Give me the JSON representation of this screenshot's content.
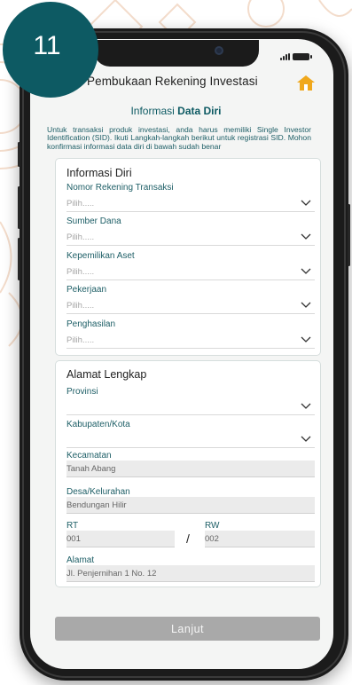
{
  "step_badge": "11",
  "header": {
    "title": "Pembukaan Rekening Investasi",
    "home_icon": "home-icon"
  },
  "section": {
    "title_prefix": "Informasi ",
    "title_bold": "Data Diri"
  },
  "info_text": "Untuk transaksi produk investasi, anda harus memiliki Single Investor Identification (SID). Ikuti Langkah-langkah berikut untuk registrasi SID. Mohon konfirmasi informasi data diri di bawah sudah benar",
  "personal": {
    "title": "Informasi Diri",
    "fields": [
      {
        "label": "Nomor Rekening Transaksi",
        "placeholder": "Pilih....."
      },
      {
        "label": "Sumber Dana",
        "placeholder": "Pilih....."
      },
      {
        "label": "Kepemilikan Aset",
        "placeholder": "Pilih....."
      },
      {
        "label": "Pekerjaan",
        "placeholder": "Pilih....."
      },
      {
        "label": "Penghasilan",
        "placeholder": "Pilih....."
      }
    ]
  },
  "address": {
    "title": "Alamat Lengkap",
    "provinsi": {
      "label": "Provinsi",
      "value": ""
    },
    "kabupaten": {
      "label": "Kabupaten/Kota",
      "value": ""
    },
    "kecamatan": {
      "label": "Kecamatan",
      "value": "Tanah Abang"
    },
    "desa": {
      "label": "Desa/Kelurahan",
      "value": "Bendungan Hilir"
    },
    "rt": {
      "label": "RT",
      "value": "001"
    },
    "separator": "/",
    "rw": {
      "label": "RW",
      "value": "002"
    },
    "alamat": {
      "label": "Alamat",
      "value": "Jl. Penjernihan 1 No. 12"
    }
  },
  "button": {
    "label": "Lanjut"
  },
  "colors": {
    "teal": "#0d5a63",
    "home_icon": "#f0a81c",
    "button_disabled": "#a9a9a9",
    "pattern": "#f3dccb"
  }
}
